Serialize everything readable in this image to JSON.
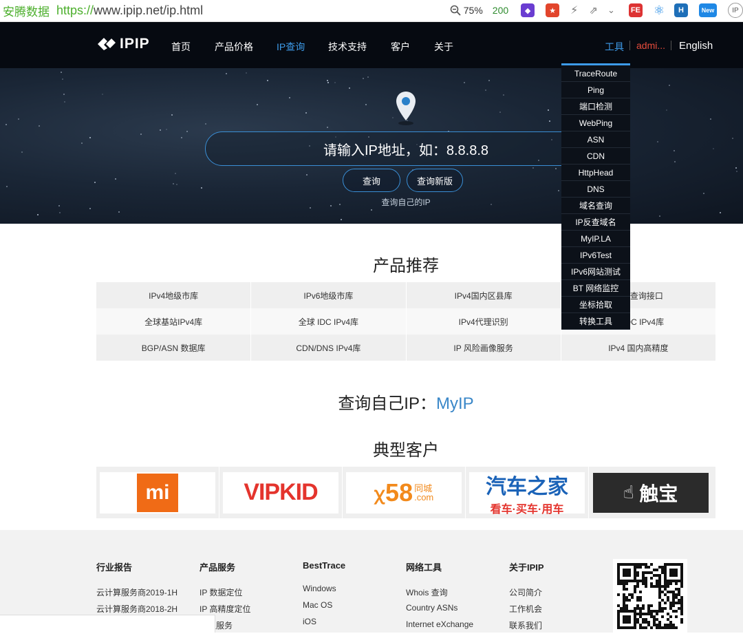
{
  "browser": {
    "site_label": "安腾数据",
    "url_scheme": "https://",
    "url_rest": "www.ipip.net/ip.html",
    "zoom": "75%",
    "count_badge": "200",
    "extensions": [
      {
        "name": "purple-cube-extension",
        "color": "#6a3dd1",
        "text": "◆"
      },
      {
        "name": "red-shield-extension",
        "color": "#e2452c",
        "text": "★"
      },
      {
        "name": "fe-extension",
        "color": "#d33",
        "text": "FE"
      },
      {
        "name": "h-extension",
        "color": "#1e6fb8",
        "text": "H"
      },
      {
        "name": "new-extension",
        "color": "#1f88e5",
        "text": "New"
      }
    ]
  },
  "nav": {
    "logo": "IPIP",
    "items": [
      "首页",
      "产品价格",
      "IP查询",
      "技术支持",
      "客户",
      "关于"
    ],
    "active": "IP查询",
    "tools": "工具",
    "admin": "admi...",
    "english": "English"
  },
  "hero": {
    "placeholder": "请输入IP地址，如：8.8.8.8",
    "query_btn": "查询",
    "new_btn": "查询新版",
    "own_ip": "查询自己的IP"
  },
  "tools_menu": [
    "TraceRoute",
    "Ping",
    "端口检测",
    "WebPing",
    "ASN",
    "CDN",
    "HttpHead",
    "DNS",
    "域名查询",
    "IP反查域名",
    "MyIP.LA",
    "IPv6Test",
    "IPv6网站测试",
    "BT 网络监控",
    "坐标拾取",
    "转换工具"
  ],
  "products": {
    "title": "产品推荐",
    "rows": [
      [
        "IPv4地级市库",
        "IPv6地级市库",
        "IPv4国内区县库",
        "市级查询接口"
      ],
      [
        "全球基站IPv4库",
        "全球 IDC IPv4库",
        "IPv4代理识别",
        "IP IDC IPv4库"
      ],
      [
        "BGP/ASN 数据库",
        "CDN/DNS IPv4库",
        "IP 风险画像服务",
        "IPv4 国内高精度"
      ]
    ]
  },
  "myip": {
    "prefix": "查询自己IP：",
    "link": "MyIP"
  },
  "customers": {
    "title": "典型客户",
    "logos": {
      "mi": "mi",
      "vipkid": "VIPKID",
      "c58_num": "58",
      "c58_cn": "同城",
      "c58_com": ".com",
      "car_main": "汽车之家",
      "car_sub": "看车·买车·用车",
      "chubao": "触宝"
    }
  },
  "footer": {
    "columns": [
      {
        "head": "行业报告",
        "links": [
          "云计算服务商2019-1H",
          "云计算服务商2018-2H"
        ]
      },
      {
        "head": "产品服务",
        "links": [
          "IP 数据定位",
          "IP 高精度定位",
          "定位服务"
        ]
      },
      {
        "head": "BestTrace",
        "links": [
          "Windows",
          "Mac OS",
          "iOS"
        ]
      },
      {
        "head": "网络工具",
        "links": [
          "Whois 查询",
          "Country ASNs",
          "Internet eXchange"
        ]
      },
      {
        "head": "关于IPIP",
        "links": [
          "公司简介",
          "工作机会",
          "联系我们"
        ]
      }
    ]
  },
  "colors": {
    "accent": "#3d9be9",
    "admin": "#e74c3c",
    "nav_bg": "#060a11"
  }
}
